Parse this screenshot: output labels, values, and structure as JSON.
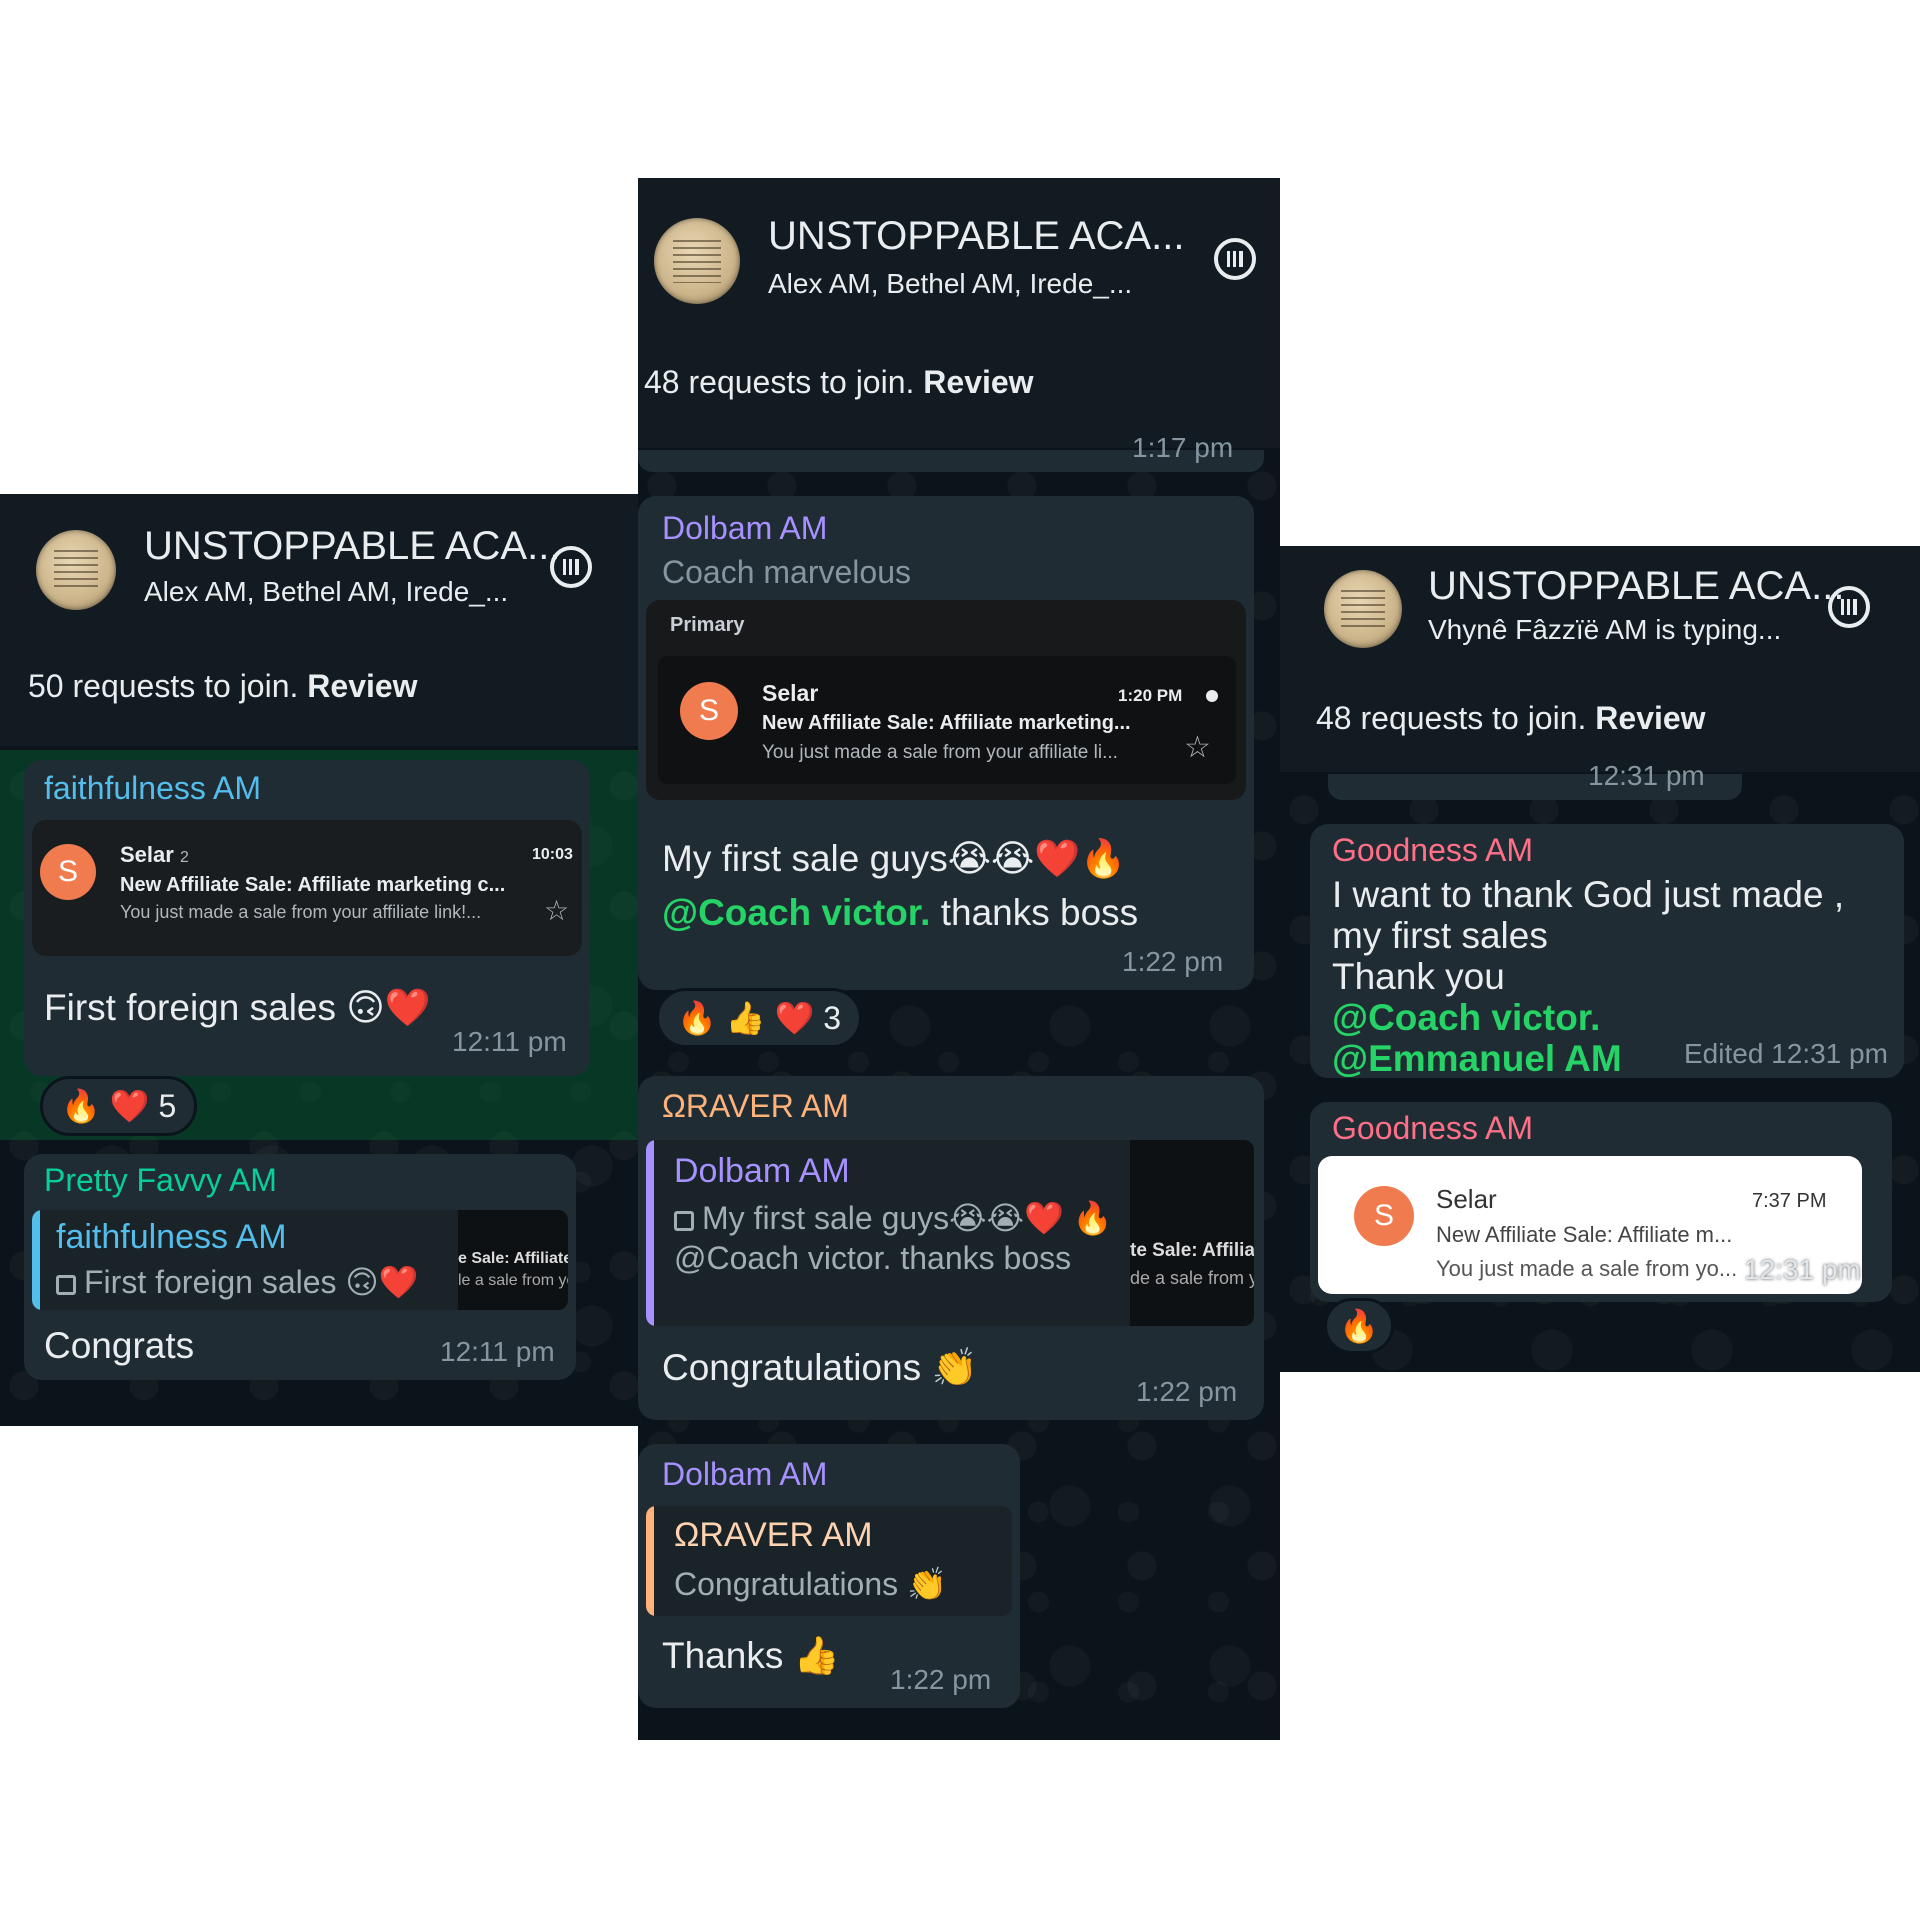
{
  "colors": {
    "green_mention": "#25d366",
    "sender_blue": "#53bdeb",
    "sender_teal": "#06cf9c",
    "sender_purple": "#a791ff",
    "sender_orange": "#ffb27a",
    "sender_pink": "#ff7088"
  },
  "left": {
    "title": "UNSTOPPABLE ACA...",
    "subtitle": "Alex AM, Bethel AM, Irede_...",
    "requests": "50 requests to join.",
    "review": "Review",
    "msg1": {
      "sender": "faithfulness AM",
      "email": {
        "from": "Selar",
        "count": "2",
        "time": "10:03",
        "subject": "New Affiliate Sale: Affiliate marketing c...",
        "body": "You just made a sale from your affiliate link!...",
        "avatar": "S"
      },
      "text": "First foreign sales 🙃❤️",
      "time": "12:11 pm",
      "reactions": "🔥 ❤️ 5"
    },
    "msg2": {
      "sender": "Pretty Favvy AM",
      "quote_name": "faithfulness AM",
      "quote_text": "First foreign sales 🙃❤️",
      "thumb_line1": "e Sale: Affiliate",
      "thumb_line2": "le a sale from yo",
      "text": "Congrats",
      "time": "12:11 pm"
    }
  },
  "middle": {
    "title": "UNSTOPPABLE ACA...",
    "subtitle": "Alex AM, Bethel AM, Irede_...",
    "requests": "48 requests to join.",
    "review": "Review",
    "top_time": "1:17 pm",
    "msg1": {
      "sender": "Dolbam AM",
      "caption": "Coach marvelous",
      "email": {
        "tab": "Primary",
        "from": "Selar",
        "time": "1:20 PM",
        "subject": "New Affiliate Sale: Affiliate marketing...",
        "body": "You just made a sale from your affiliate li...",
        "avatar": "S"
      },
      "text_main": "My first sale guys😭😭❤️🔥",
      "mention": "@Coach victor.",
      "text_after": " thanks boss",
      "time": "1:22 pm",
      "reactions": "🔥 👍 ❤️ 3"
    },
    "msg2": {
      "sender": "ΩRAVER AM",
      "quote_name": "Dolbam AM",
      "quote_text": "My first sale guys😭😭❤️ 🔥 @Coach victor. thanks boss",
      "thumb_line1": "te Sale: Affilia",
      "thumb_line2": "de a sale from y",
      "text": "Congratulations 👏",
      "time": "1:22 pm"
    },
    "msg3": {
      "sender": "Dolbam AM",
      "quote_name": "ΩRAVER AM",
      "quote_text": "Congratulations 👏",
      "text": "Thanks 👍",
      "time": "1:22 pm"
    }
  },
  "right": {
    "title": "UNSTOPPABLE ACA...",
    "subtitle": "Vhynê Fâzzïë AM is typing...",
    "requests": "48 requests to join.",
    "review": "Review",
    "top_time": "12:31 pm",
    "msg1": {
      "sender": "Goodness AM",
      "line1": "I want to thank God just made ,",
      "line2": "my first sales",
      "line3": "Thank you",
      "mention1": "@Coach victor.",
      "mention2": "@Emmanuel AM",
      "time": "Edited 12:31 pm"
    },
    "msg2": {
      "sender": "Goodness AM",
      "email": {
        "from": "Selar",
        "time": "7:37 PM",
        "subject": "New Affiliate Sale: Affiliate m...",
        "body": "You just made a sale from yo...",
        "avatar": "S"
      },
      "time": "12:31 pm",
      "reactions": "🔥"
    }
  }
}
